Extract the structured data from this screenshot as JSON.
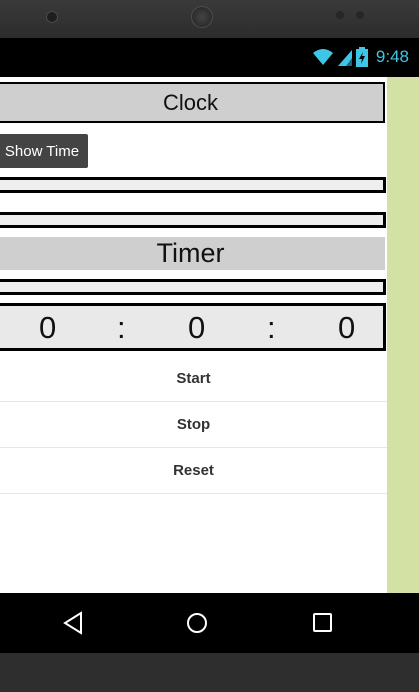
{
  "status": {
    "time": "9:48",
    "icons": [
      "wifi-icon",
      "signal-icon",
      "battery-charging-icon"
    ]
  },
  "clock": {
    "header": "Clock",
    "show_time_label": "Show Time",
    "textbox1_value": "",
    "textbox2_value": ""
  },
  "timer": {
    "header": "Timer",
    "textbox_value": "",
    "hours": "0",
    "sep1": ":",
    "minutes": "0",
    "sep2": ":",
    "seconds": "0"
  },
  "actions": {
    "start": "Start",
    "stop": "Stop",
    "reset": "Reset"
  },
  "nav": {
    "icons": [
      "back-icon",
      "home-icon",
      "recents-icon"
    ]
  },
  "colors": {
    "accent": "#3fc6e6",
    "header_bg": "#cfcfcf",
    "button_bg": "#444444",
    "side_strip": "#d4e1a5"
  }
}
